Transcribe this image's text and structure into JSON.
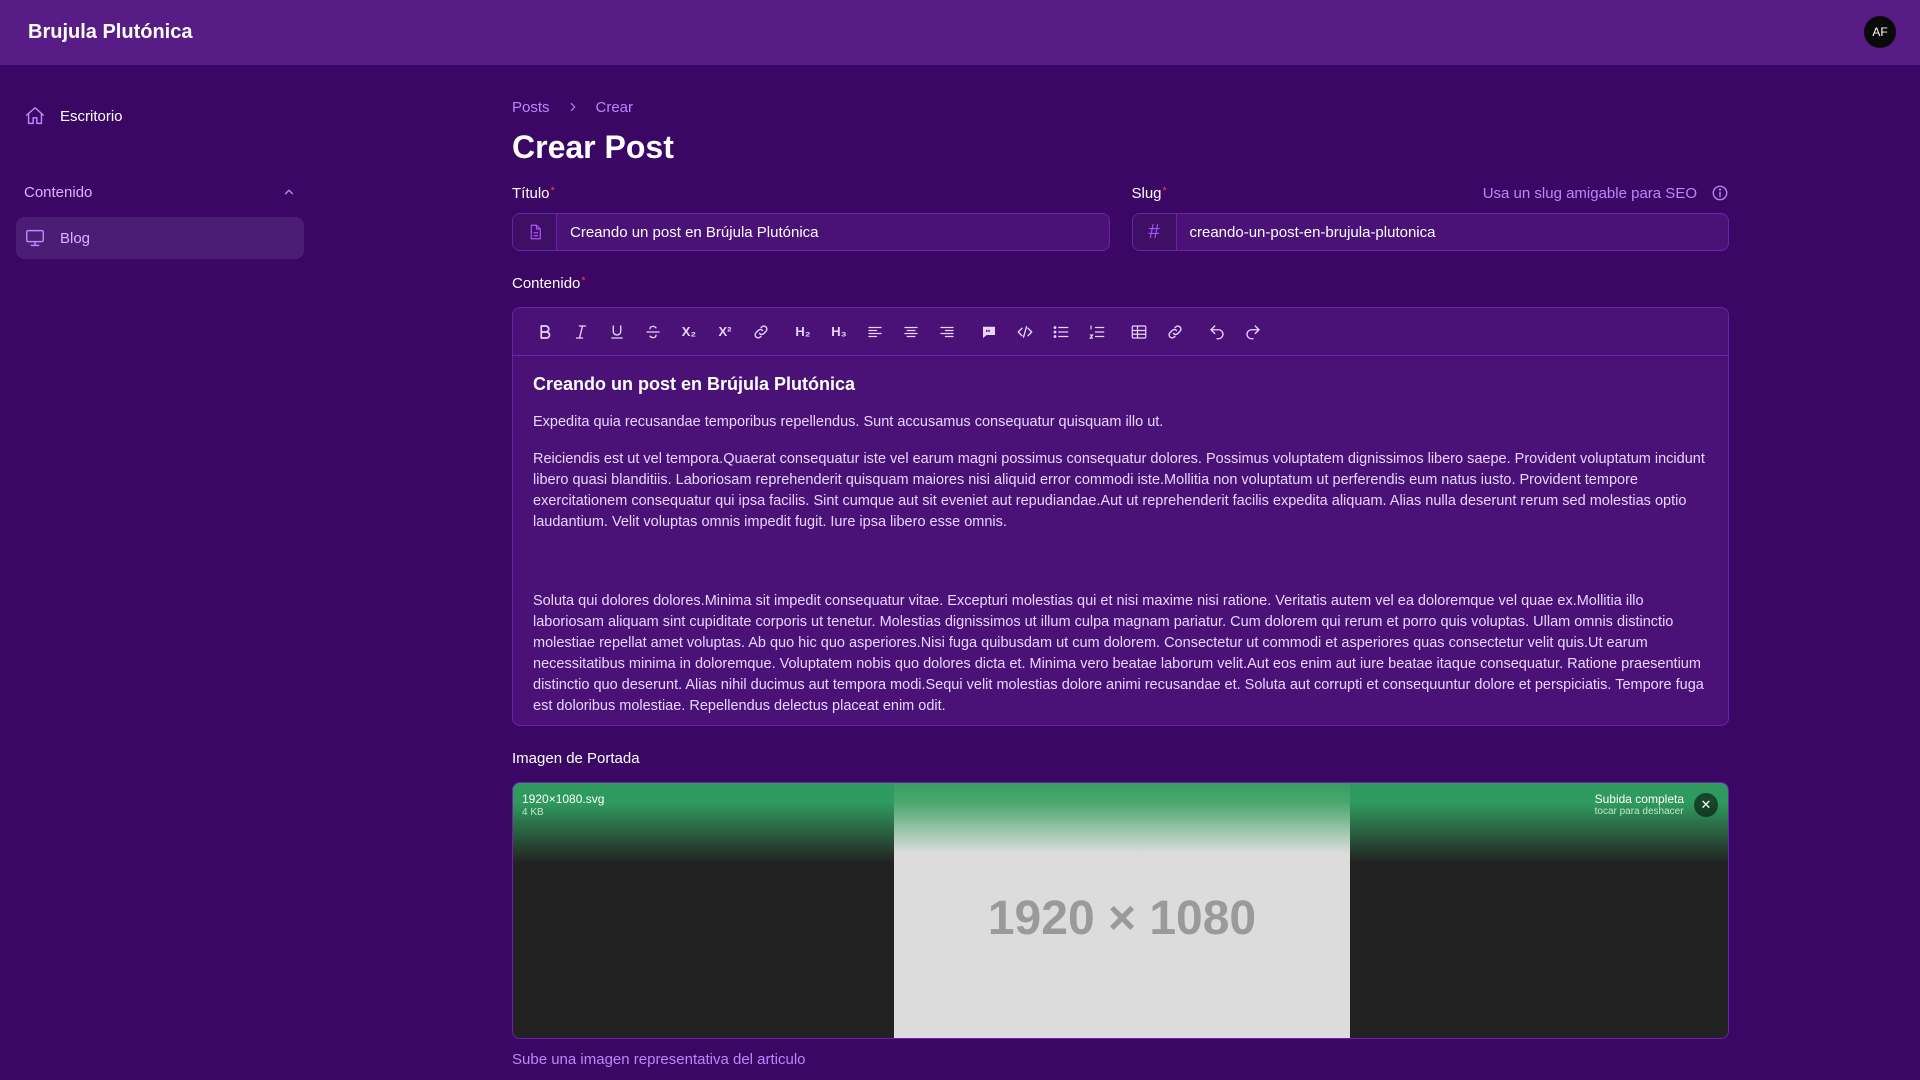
{
  "app": {
    "brand": "Brujula Plutónica",
    "avatar_initials": "AF"
  },
  "sidebar": {
    "dashboard_label": "Escritorio",
    "group_label": "Contenido",
    "items": [
      {
        "label": "Blog",
        "icon": "monitor-icon"
      }
    ]
  },
  "breadcrumb": {
    "parent": "Posts",
    "current": "Crear"
  },
  "page": {
    "title": "Crear Post"
  },
  "form": {
    "title_label": "Título",
    "title_value": "Creando un post en Brújula Plutónica",
    "slug_label": "Slug",
    "slug_hint": "Usa un slug amigable para SEO",
    "slug_prefix": "#",
    "slug_value": "creando-un-post-en-brujula-plutonica",
    "content_label": "Contenido",
    "required_mark": "*"
  },
  "toolbar": {
    "h2": "H₂",
    "h3": "H₃",
    "subscript": "X₂",
    "superscript": "X²"
  },
  "editor": {
    "heading": "Creando un post en Brújula Plutónica",
    "p1": "Expedita quia recusandae temporibus repellendus. Sunt accusamus consequatur quisquam illo ut.",
    "p2": "Reiciendis est ut vel tempora.Quaerat consequatur iste vel earum magni possimus consequatur dolores. Possimus voluptatem dignissimos libero saepe. Provident voluptatum incidunt libero quasi blanditiis. Laboriosam reprehenderit quisquam maiores nisi aliquid error commodi iste.Mollitia non voluptatum ut perferendis eum natus iusto. Provident tempore exercitationem consequatur qui ipsa facilis. Sint cumque aut sit eveniet aut repudiandae.Aut ut reprehenderit facilis expedita aliquam. Alias nulla deserunt rerum sed molestias optio laudantium. Velit voluptas omnis impedit fugit. Iure ipsa libero esse omnis.",
    "p3": "Soluta qui dolores dolores.Minima sit impedit consequatur vitae. Excepturi molestias qui et nisi maxime nisi ratione. Veritatis autem vel ea doloremque vel quae ex.Mollitia illo laboriosam aliquam sint cupiditate corporis ut tenetur. Molestias dignissimos ut illum culpa magnam pariatur. Cum dolorem qui rerum et porro quis voluptas. Ullam omnis distinctio molestiae repellat amet voluptas. Ab quo hic quo asperiores.Nisi fuga quibusdam ut cum dolorem. Consectetur ut commodi et asperiores quas consectetur velit quis.Ut earum necessitatibus minima in doloremque. Voluptatem nobis quo dolores dicta et. Minima vero beatae laborum velit.Aut eos enim aut iure beatae itaque consequatur. Ratione praesentium distinctio quo deserunt. Alias nihil ducimus aut tempora modi.Sequi velit molestias dolore animi recusandae et. Soluta aut corrupti et consequuntur dolore et perspiciatis. Tempore fuga est doloribus molestiae. Repellendus delectus placeat enim odit."
  },
  "upload": {
    "label": "Imagen de Portada",
    "file_name": "1920×1080.svg",
    "file_size": "4 KB",
    "status": "Subida completa",
    "status_sub": "tocar para deshacer",
    "image_text": "1920 × 1080",
    "helper": "Sube una imagen representativa del articulo"
  }
}
